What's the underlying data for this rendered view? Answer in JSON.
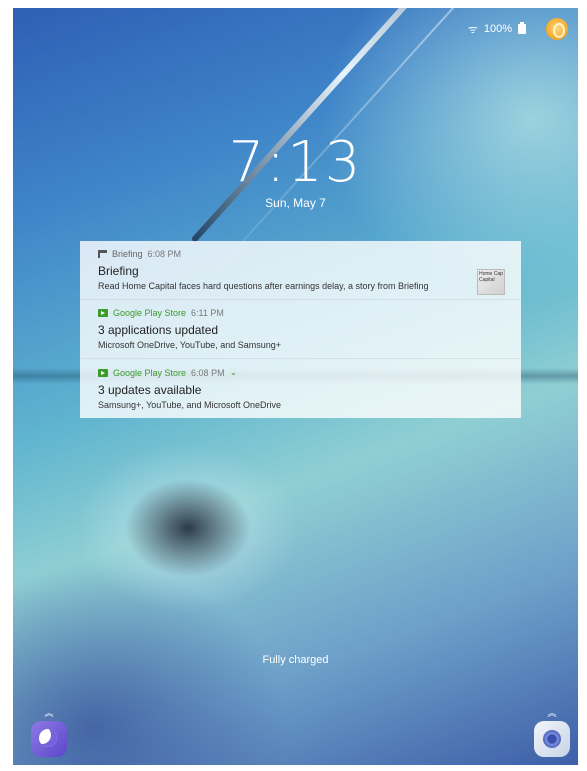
{
  "status_bar": {
    "wifi": "ᯤ",
    "battery": "100%"
  },
  "lock_screen": {
    "time": "7:13",
    "date": "Sun, May 7",
    "charging_status": "Fully charged"
  },
  "notifications": [
    {
      "app": "Briefing",
      "time": "6:08 PM",
      "title": "Briefing",
      "text": "Read Home Capital faces hard questions after earnings delay, a story from Briefing",
      "thumbnail_text": "Home Cap Capital"
    },
    {
      "app": "Google Play Store",
      "time": "6:11 PM",
      "title": "3 applications updated",
      "text": "Microsoft OneDrive, YouTube, and Samsung+"
    },
    {
      "app": "Google Play Store",
      "time": "6:08 PM",
      "title": "3 updates available",
      "text": "Samsung+, YouTube, and Microsoft OneDrive"
    }
  ],
  "shortcuts": {
    "left_arrow": "︽",
    "right_arrow": "︽"
  },
  "colors": {
    "play_green": "#3a9a2a",
    "accent_avatar": "#f5a623"
  }
}
